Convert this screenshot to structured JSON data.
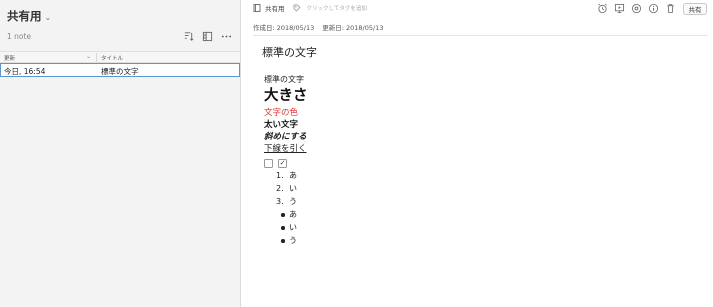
{
  "left": {
    "notebook_title": "共有用",
    "note_count": "1 note",
    "columns": {
      "updated": "更新",
      "title": "タイトル"
    },
    "rows": [
      {
        "updated": "今日, 16:54",
        "title": "標準の文字"
      }
    ]
  },
  "right": {
    "notebook": "共有用",
    "tag_placeholder": "クリックしてタグを追加",
    "created": "作成日: 2018/05/13",
    "updated": "更新日: 2018/05/13",
    "share_label": "共有",
    "toolbar_icons": [
      "alarm-icon",
      "present-icon",
      "at-icon",
      "info-icon",
      "trash-icon"
    ]
  },
  "note": {
    "title": "標準の文字",
    "normal": "標準の文字",
    "large": "大きさ",
    "colored": "文字の色",
    "colored_color": "#e03131",
    "bold": "太い文字",
    "italic": "斜めにする",
    "underline": "下線を引く",
    "checkboxes": [
      {
        "checked": false
      },
      {
        "checked": true,
        "mark": "✓"
      }
    ],
    "ordered": [
      {
        "n": "1.",
        "text": "あ"
      },
      {
        "n": "2.",
        "text": "い"
      },
      {
        "n": "3.",
        "text": "う"
      }
    ],
    "bullets": [
      "あ",
      "い",
      "う"
    ]
  }
}
